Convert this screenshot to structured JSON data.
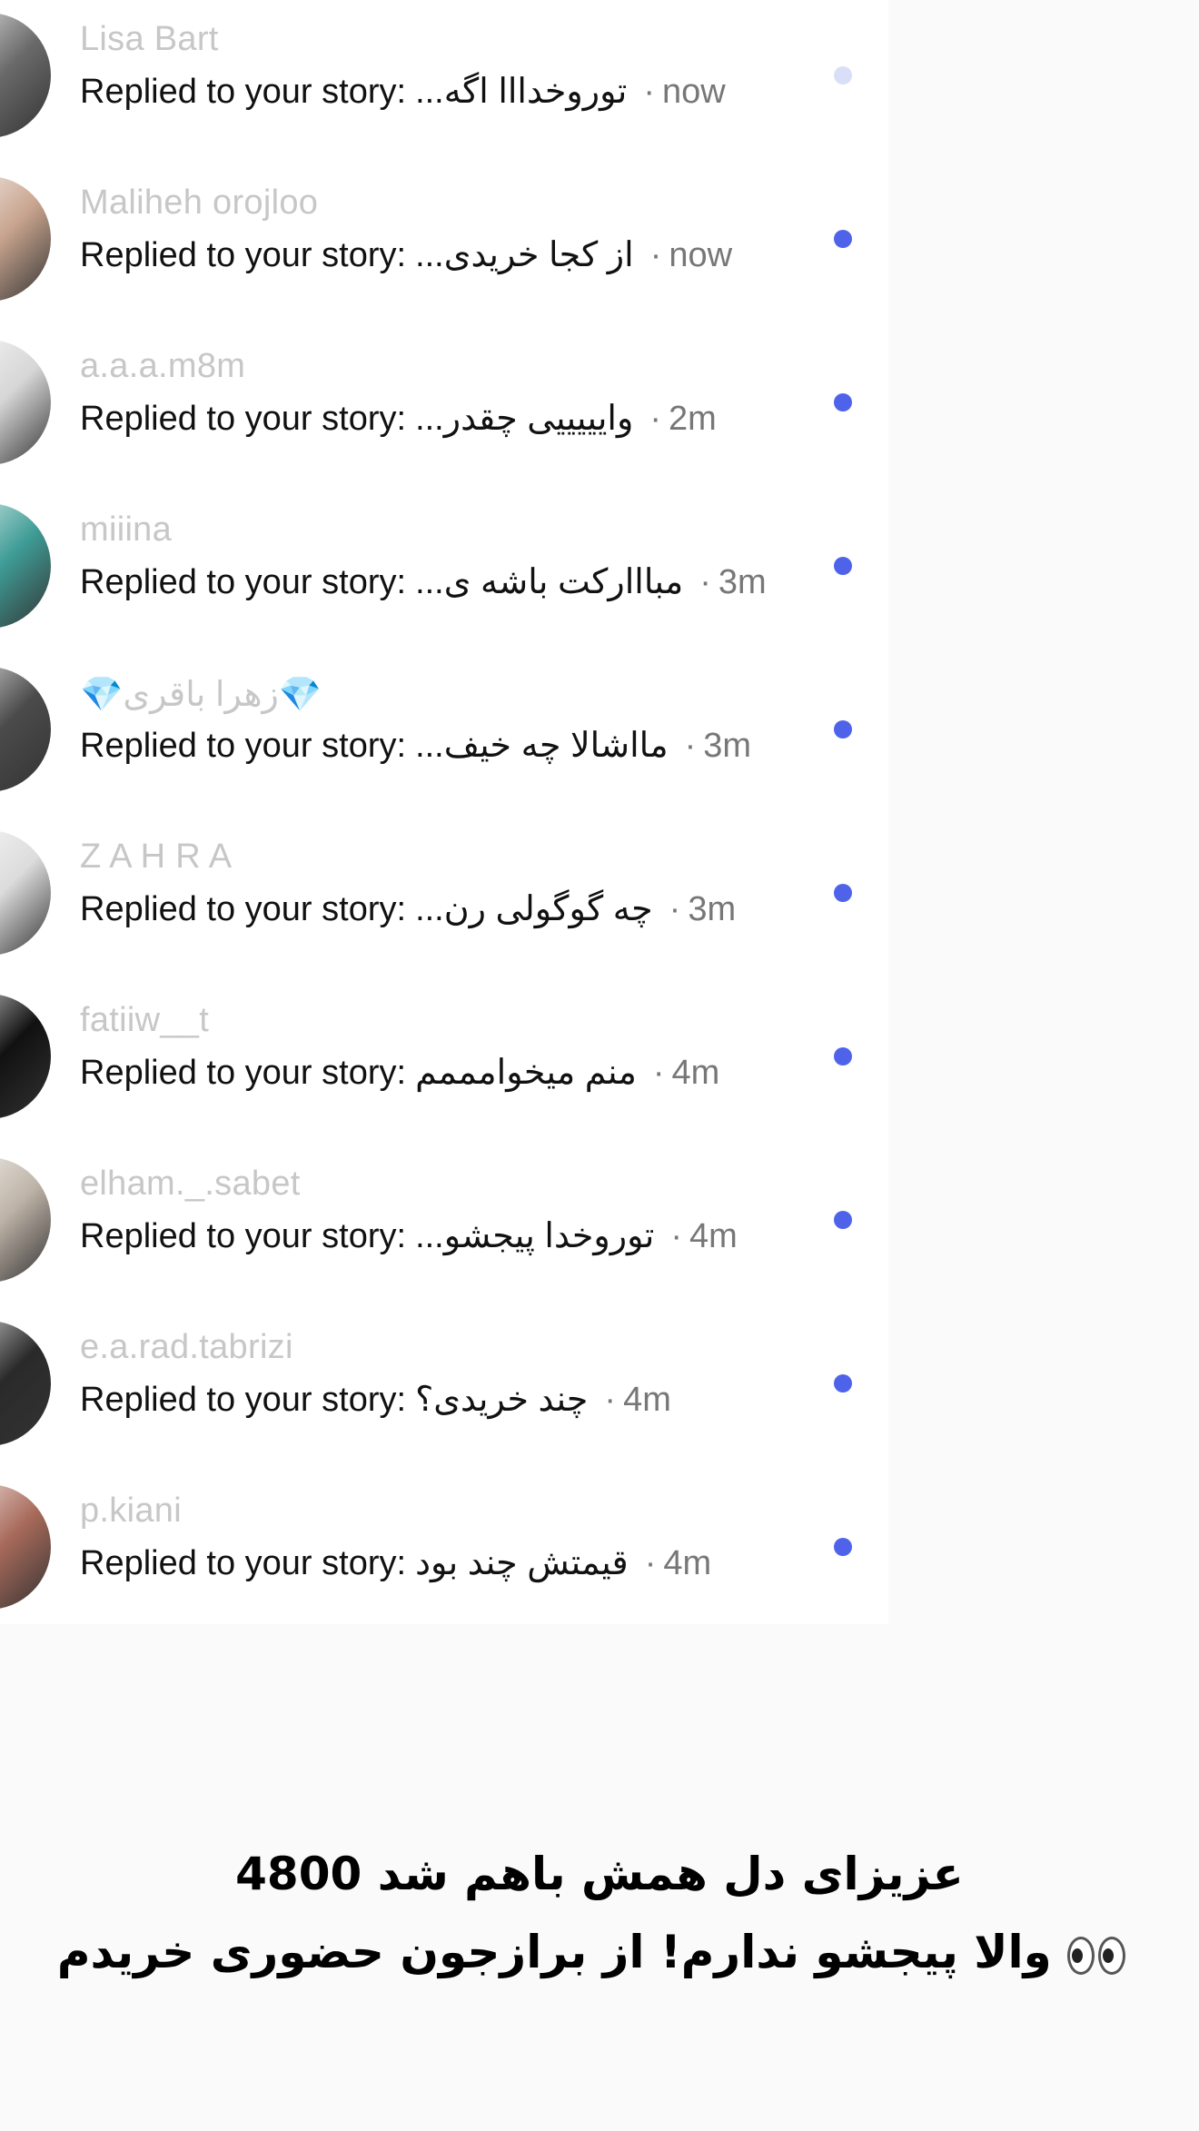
{
  "notifications": [
    {
      "username": "Lisa Bart",
      "prefix": "Replied to your story:",
      "quote": "توروخدااا اگه...",
      "time": "now",
      "avatar_color": "#6a6a6a",
      "dot": "faded"
    },
    {
      "username": "Maliheh orojloo",
      "prefix": "Replied to your story:",
      "quote": "از کجا خریدی...",
      "time": "now",
      "avatar_color": "#c8a48e",
      "dot": "solid"
    },
    {
      "username": "a.a.a.m8m",
      "prefix": "Replied to your story:",
      "quote": "وایییییی چقدر...",
      "time": "2m",
      "avatar_color": "#d6d6d6",
      "dot": "solid"
    },
    {
      "username": "miiina",
      "prefix": "Replied to your story:",
      "quote": "مبااارکت باشه ی...",
      "time": "3m",
      "avatar_color": "#3f9c96",
      "dot": "solid"
    },
    {
      "username": "💎زهرا باقری💎",
      "prefix": "Replied to your story:",
      "quote": "مااشالا چه خیف...",
      "time": "3m",
      "avatar_color": "#4b4b4b",
      "dot": "solid"
    },
    {
      "username": "Z A H R A",
      "prefix": "Replied to your story:",
      "quote": "چه گوگولی رن...",
      "time": "3m",
      "avatar_color": "#dcdcdc",
      "dot": "solid"
    },
    {
      "username": "fatiiw__t",
      "prefix": "Replied to your story:",
      "quote": "منم میخوامممم",
      "time": "4m",
      "avatar_color": "#111111",
      "dot": "solid"
    },
    {
      "username": "elham._.sabet",
      "prefix": "Replied to your story:",
      "quote": "توروخدا پیجشو...",
      "time": "4m",
      "avatar_color": "#bfb4a8",
      "dot": "solid"
    },
    {
      "username": "e.a.rad.tabrizi",
      "prefix": "Replied to your story:",
      "quote": "چند خریدی؟",
      "time": "4m",
      "avatar_color": "#2a2a2a",
      "dot": "solid"
    },
    {
      "username": "p.kiani",
      "prefix": "Replied to your story:",
      "quote": "قیمتش چند بود",
      "time": "4m",
      "avatar_color": "#a86a5a",
      "dot": "solid"
    }
  ],
  "separator": "·",
  "caption": {
    "line1": "عزیزای دل همش باهم شد 4800",
    "line2": "والا پیجشو ندارم! از برازجون حضوری خریدم"
  },
  "colors": {
    "unread_dot": "#4f63ea",
    "username": "#c7c7c7",
    "time": "#777777"
  }
}
